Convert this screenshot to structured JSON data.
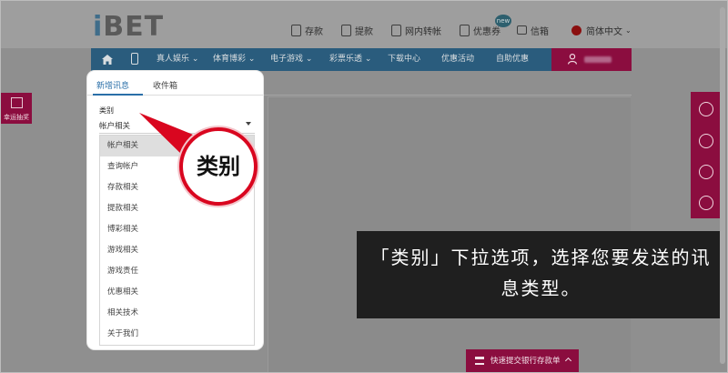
{
  "header": {
    "logo": "iBET",
    "nav": [
      {
        "label": "存款",
        "icon": "deposit-icon"
      },
      {
        "label": "提款",
        "icon": "withdraw-icon"
      },
      {
        "label": "网内转帐",
        "icon": "transfer-icon"
      },
      {
        "label": "优惠券",
        "icon": "coupon-icon",
        "badge": "new"
      },
      {
        "label": "信箱",
        "icon": "mail-icon"
      },
      {
        "label": "简体中文",
        "icon": "china-flag-icon"
      }
    ]
  },
  "navbar": {
    "items": [
      "真人娱乐",
      "体育博彩",
      "电子游戏",
      "彩票乐透",
      "下载中心",
      "优惠活动",
      "自助优惠"
    ],
    "user_icon": "user-icon"
  },
  "tabs": {
    "new_message": "新增讯息",
    "inbox": "收件箱"
  },
  "form": {
    "category_label": "类别",
    "selected": "帐户相关",
    "options": [
      "帐户相关",
      "查询帐户",
      "存款相关",
      "提款相关",
      "博彩相关",
      "游戏相关",
      "游戏责任",
      "优惠相关",
      "相关技术",
      "关于我们"
    ]
  },
  "callout": {
    "label": "类别"
  },
  "caption": {
    "text": "「类别」下拉选项，选择您要发送的讯息类型。"
  },
  "side": {
    "lucky_draw": "幸运抽奖"
  },
  "bank_button": {
    "label": "快速提交银行存款单"
  },
  "colors": {
    "brand_maroon": "#8b0d3f",
    "nav_blue": "#2a5c7d",
    "callout_red": "#d9061f"
  }
}
